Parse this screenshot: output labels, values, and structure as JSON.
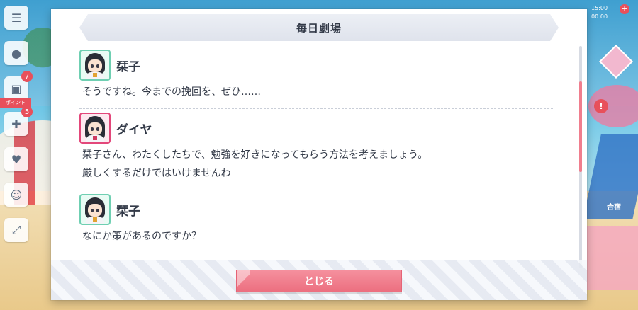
{
  "hud": {
    "left_badges": [
      "7",
      "5"
    ],
    "left_ribbon": "ポイント",
    "status_line1": "15:00",
    "status_line2": "00:00",
    "right_label": "合宿"
  },
  "dialog": {
    "title": "毎日劇場",
    "entries": [
      {
        "speaker": "栞子",
        "avatar": "shioriko-avatar",
        "frame_color": "#6fcfb2",
        "lines": [
          "そうですね。今までの挽回を、ぜひ……"
        ]
      },
      {
        "speaker": "ダイヤ",
        "avatar": "dia-avatar",
        "frame_color": "#e3477a",
        "lines": [
          "栞子さん、わたくしたちで、勉強を好きになってもらう方法を考えましょう。",
          "厳しくするだけではいけませんわ"
        ]
      },
      {
        "speaker": "栞子",
        "avatar": "shioriko-avatar",
        "frame_color": "#6fcfb2",
        "lines": [
          "なにか策があるのですか？"
        ]
      }
    ],
    "close_label": "とじる",
    "scroll_position": 0.27
  },
  "colors": {
    "accent": "#f07e8e",
    "text": "#333a48",
    "title_bar": "#e3e7ef"
  }
}
